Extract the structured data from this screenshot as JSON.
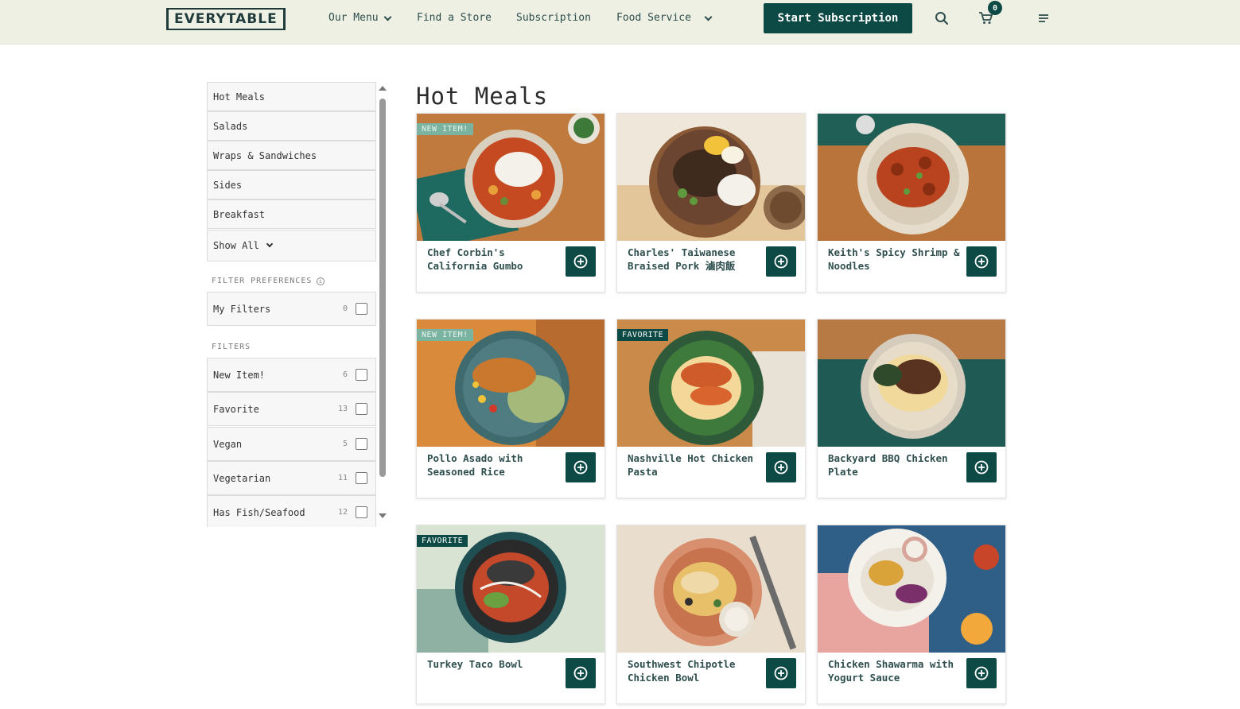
{
  "header": {
    "logo": "EVERYTABLE",
    "nav": [
      {
        "label": "Our Menu",
        "has_dropdown": true
      },
      {
        "label": "Find a Store",
        "has_dropdown": false
      },
      {
        "label": "Subscription",
        "has_dropdown": false
      },
      {
        "label": "Food Service",
        "has_dropdown": true
      }
    ],
    "cta_label": "Start Subscription",
    "cart_count": "0",
    "icons": [
      "search-icon",
      "cart-icon",
      "menu-icon"
    ],
    "accent_color": "#0e4a45",
    "header_bg": "#eef0e3"
  },
  "sidebar": {
    "categories": [
      "Hot Meals",
      "Salads",
      "Wraps & Sandwiches",
      "Sides",
      "Breakfast"
    ],
    "show_all": "Show All",
    "filter_preferences_label": "FILTER PREFERENCES",
    "my_filters": {
      "label": "My Filters",
      "count": "0"
    },
    "filters_label": "FILTERS",
    "filters": [
      {
        "label": "New Item!",
        "count": "6"
      },
      {
        "label": "Favorite",
        "count": "13"
      },
      {
        "label": "Vegan",
        "count": "5"
      },
      {
        "label": "Vegetarian",
        "count": "11"
      },
      {
        "label": "Has Fish/Seafood",
        "count": "12"
      }
    ]
  },
  "main": {
    "title": "Hot Meals",
    "tags": {
      "new": "NEW ITEM!",
      "favorite": "FAVORITE"
    },
    "cards": [
      {
        "name": "Chef Corbin's California Gumbo",
        "tag": "NEW ITEM!"
      },
      {
        "name": "Charles' Taiwanese Braised Pork 滷肉飯",
        "tag": ""
      },
      {
        "name": "Keith's Spicy Shrimp & Noodles",
        "tag": ""
      },
      {
        "name": "Pollo Asado with Seasoned Rice",
        "tag": "NEW ITEM!"
      },
      {
        "name": "Nashville Hot Chicken Pasta",
        "tag": "FAVORITE"
      },
      {
        "name": "Backyard BBQ Chicken Plate",
        "tag": ""
      },
      {
        "name": "Turkey Taco Bowl",
        "tag": "FAVORITE"
      },
      {
        "name": "Southwest Chipotle Chicken Bowl",
        "tag": ""
      },
      {
        "name": "Chicken Shawarma with Yogurt Sauce",
        "tag": ""
      }
    ]
  }
}
